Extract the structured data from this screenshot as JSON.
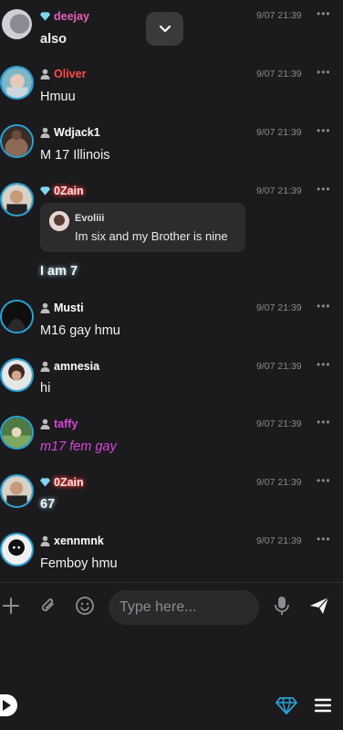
{
  "messages": [
    {
      "user": "deejay",
      "role": "diamond",
      "name_color": "#e85fb8",
      "time": "9/07 21:39",
      "text": "also",
      "text_style": "bold"
    },
    {
      "user": "Oliver",
      "role": "user",
      "name_color": "#ff4a4a",
      "time": "9/07 21:39",
      "text": "Hmuu"
    },
    {
      "user": "Wdjack1",
      "role": "user",
      "name_color": "#ffffff",
      "time": "9/07 21:39",
      "text": "M 17 Illinois"
    },
    {
      "user": "0Zain",
      "role": "diamond",
      "name_color": "#ff3b3b",
      "time": "9/07 21:39",
      "reply": {
        "user": "Evoliii",
        "text": "Im six and my Brother is nine"
      },
      "text": "I am 7",
      "text_style": "glow"
    },
    {
      "user": "Musti",
      "role": "user",
      "name_color": "#ffffff",
      "time": "9/07 21:39",
      "text": "M16 gay hmu"
    },
    {
      "user": "amnesia",
      "role": "user",
      "name_color": "#ffffff",
      "time": "9/07 21:39",
      "text": "hi"
    },
    {
      "user": "taffy",
      "role": "user",
      "name_color": "#d946d9",
      "time": "9/07 21:39",
      "text": "m17 fem gay",
      "text_style": "italic-pink"
    },
    {
      "user": "0Zain",
      "role": "diamond",
      "name_color": "#ff3b3b",
      "time": "9/07 21:39",
      "text": "67",
      "text_style": "glow"
    },
    {
      "user": "xennmnk",
      "role": "user",
      "name_color": "#ffffff",
      "time": "9/07 21:39",
      "text": "Femboy hmu"
    }
  ],
  "more_glyph": "•••",
  "composer": {
    "placeholder": "Type here..."
  },
  "colors": {
    "accent": "#2aa3d8",
    "background": "#1b1b1d",
    "diamond": "#7fd6f0"
  },
  "icons": [
    "chevron-down-icon",
    "plus-icon",
    "paperclip-icon",
    "emoji-icon",
    "microphone-icon",
    "send-icon",
    "play-icon",
    "diamond-icon",
    "menu-icon"
  ]
}
